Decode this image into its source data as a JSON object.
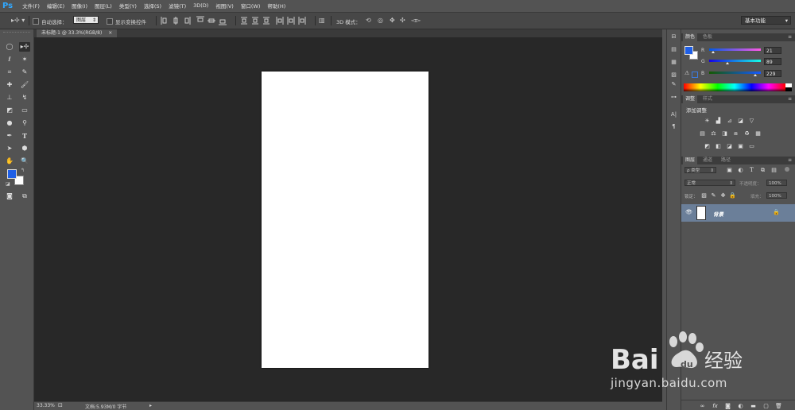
{
  "app": {
    "logo": "Ps"
  },
  "menu": [
    "文件(F)",
    "编辑(E)",
    "图像(I)",
    "图层(L)",
    "类型(Y)",
    "选择(S)",
    "滤镜(T)",
    "3D(D)",
    "视图(V)",
    "窗口(W)",
    "帮助(H)"
  ],
  "options": {
    "auto_select_label": "自动选择：",
    "auto_select_value": "图层",
    "show_transform_label": "显示变换控件",
    "mode_3d_label": "3D 模式：",
    "workspace": "基本功能"
  },
  "document": {
    "tab_title": "未标题-1 @ 33.3%(RGB/8)",
    "tab_close": "×"
  },
  "status": {
    "zoom": "33.33%",
    "doc_info": "文档:5.93M/0 字节"
  },
  "color_panel": {
    "tabs": [
      "颜色",
      "色板"
    ],
    "foreground": "#1f5fe6",
    "background": "#ffffff",
    "channels": [
      {
        "label": "R",
        "value": "21",
        "fraction": 0.082
      },
      {
        "label": "G",
        "value": "89",
        "fraction": 0.349
      },
      {
        "label": "B",
        "value": "229",
        "fraction": 0.898
      }
    ]
  },
  "adjustments_panel": {
    "tabs": [
      "调整",
      "样式"
    ],
    "heading": "添加调整"
  },
  "layers_panel": {
    "tabs": [
      "图层",
      "通道",
      "路径"
    ],
    "filter_kind": "ρ 类型",
    "blend_mode": "正常",
    "opacity_label": "不透明度：",
    "opacity_value": "100%",
    "lock_label": "锁定：",
    "fill_label": "填充：",
    "fill_value": "100%",
    "layers": [
      {
        "name": "背景",
        "visible": true,
        "locked": true
      }
    ]
  },
  "watermark": {
    "brand_left": "Bai",
    "brand_right": "经验",
    "url": "jingyan.baidu.com"
  }
}
